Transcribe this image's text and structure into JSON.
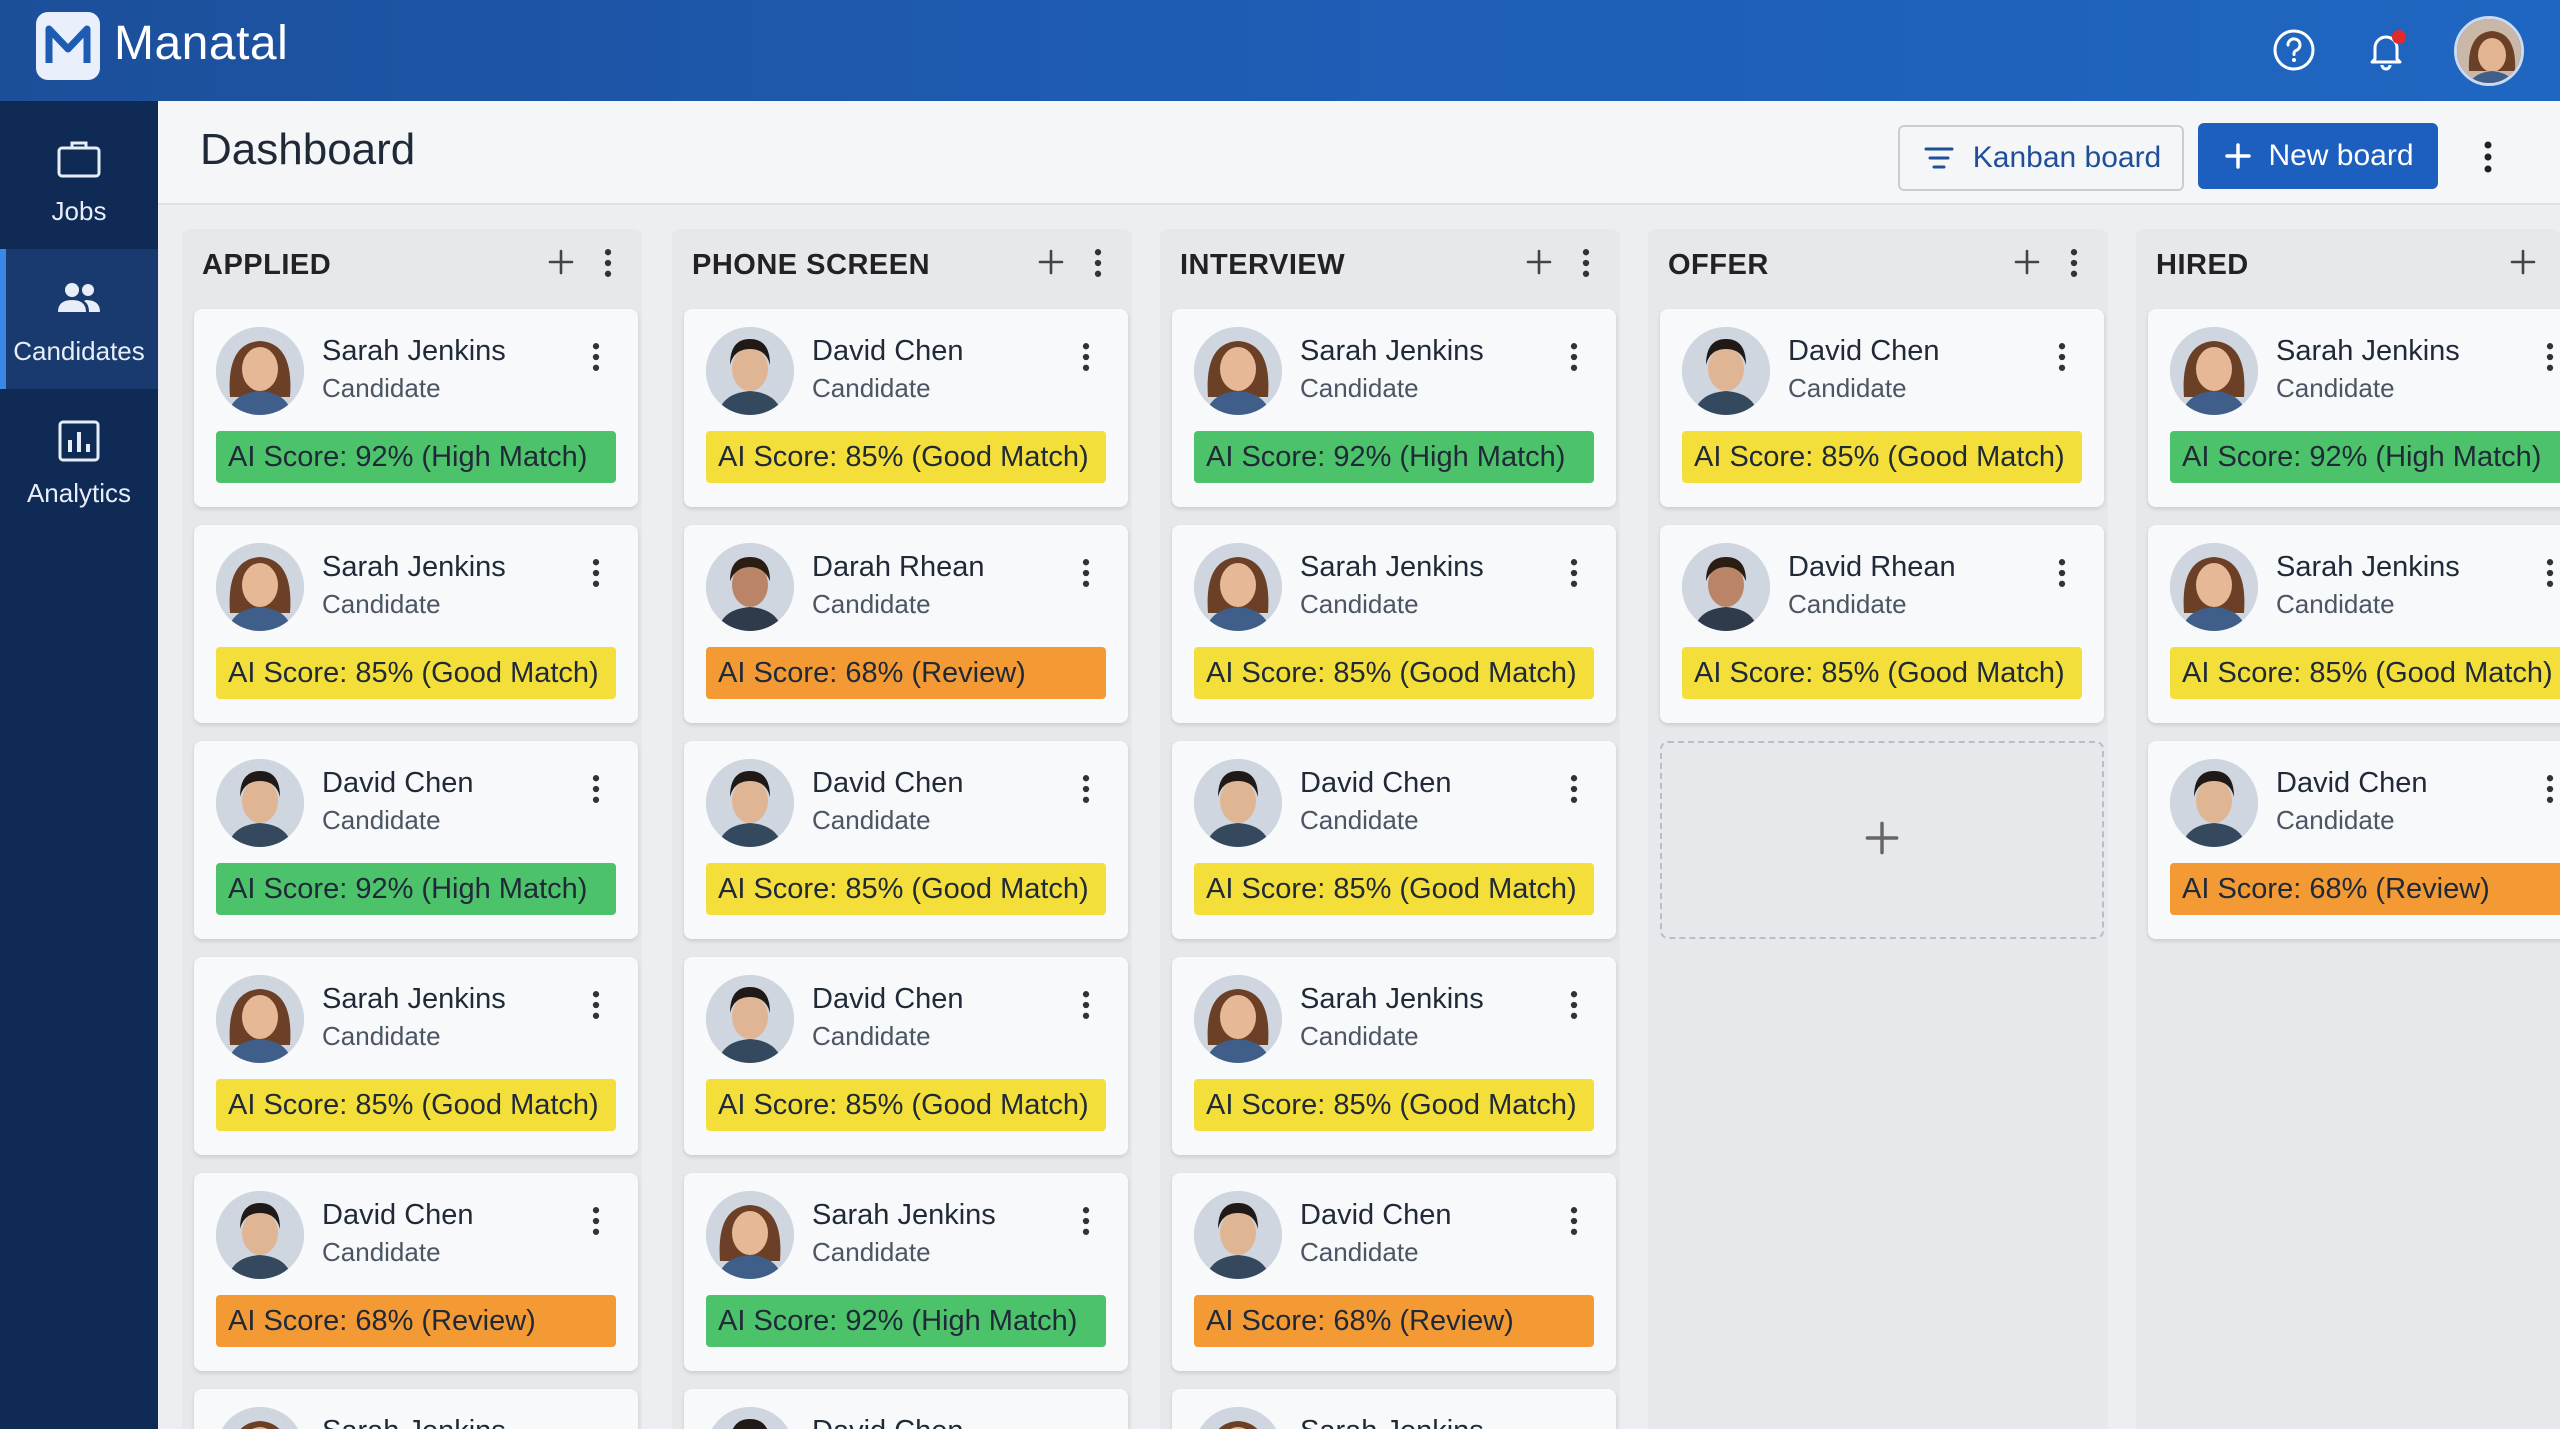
{
  "app": {
    "brand": "Manatal",
    "logo_letter": "M"
  },
  "topbar": {
    "help_icon": "help-circle-icon",
    "notification_icon": "bell-icon",
    "avatar": "user-avatar"
  },
  "sidebar": {
    "items": [
      {
        "label": "Jobs",
        "icon": "briefcase-icon",
        "active": false
      },
      {
        "label": "Candidates",
        "icon": "users-icon",
        "active": true
      },
      {
        "label": "Analytics",
        "icon": "bar-chart-icon",
        "active": false
      }
    ]
  },
  "header": {
    "title": "Dashboard",
    "kanban_label": "Kanban board",
    "new_board_label": "New board"
  },
  "colors": {
    "high_match": "#4cc26a",
    "good_match": "#f4df3a",
    "review": "#f39a35",
    "primary": "#1d5fbf",
    "topbar": "#1e5cb3",
    "sidebar": "#0f2a55"
  },
  "columns": [
    {
      "title": "APPLIED",
      "cards": [
        {
          "name": "Sarah Jenkins",
          "role": "Candidate",
          "score": "AI Score: 92% (High Match)",
          "level": "green",
          "person": "f"
        },
        {
          "name": "Sarah Jenkins",
          "role": "Candidate",
          "score": "AI Score: 85% (Good Match)",
          "level": "yellow",
          "person": "f"
        },
        {
          "name": "David Chen",
          "role": "Candidate",
          "score": "AI Score: 92% (High Match)",
          "level": "green",
          "person": "m"
        },
        {
          "name": "Sarah Jenkins",
          "role": "Candidate",
          "score": "AI Score: 85% (Good Match)",
          "level": "yellow",
          "person": "f"
        },
        {
          "name": "David Chen",
          "role": "Candidate",
          "score": "AI Score: 68% (Review)",
          "level": "orange",
          "person": "m"
        }
      ],
      "partial": {
        "name": "Sarah Jenkins",
        "person": "f"
      }
    },
    {
      "title": "PHONE SCREEN",
      "cards": [
        {
          "name": "David Chen",
          "role": "Candidate",
          "score": "AI Score: 85% (Good Match)",
          "level": "yellow",
          "person": "m"
        },
        {
          "name": "Darah Rhean",
          "role": "Candidate",
          "score": "AI Score: 68% (Review)",
          "level": "orange",
          "person": "m2"
        },
        {
          "name": "David Chen",
          "role": "Candidate",
          "score": "AI Score: 85% (Good Match)",
          "level": "yellow",
          "person": "m"
        },
        {
          "name": "David Chen",
          "role": "Candidate",
          "score": "AI Score: 85% (Good Match)",
          "level": "yellow",
          "person": "m"
        },
        {
          "name": "Sarah Jenkins",
          "role": "Candidate",
          "score": "AI Score: 92% (High Match)",
          "level": "green",
          "person": "f"
        }
      ],
      "partial": {
        "name": "David Chen",
        "person": "m"
      }
    },
    {
      "title": "INTERVIEW",
      "cards": [
        {
          "name": "Sarah Jenkins",
          "role": "Candidate",
          "score": "AI Score: 92% (High Match)",
          "level": "green",
          "person": "f"
        },
        {
          "name": "Sarah Jenkins",
          "role": "Candidate",
          "score": "AI Score: 85% (Good Match)",
          "level": "yellow",
          "person": "f"
        },
        {
          "name": "David Chen",
          "role": "Candidate",
          "score": "AI Score: 85% (Good Match)",
          "level": "yellow",
          "person": "m"
        },
        {
          "name": "Sarah Jenkins",
          "role": "Candidate",
          "score": "AI Score: 85% (Good Match)",
          "level": "yellow",
          "person": "f"
        },
        {
          "name": "David Chen",
          "role": "Candidate",
          "score": "AI Score: 68% (Review)",
          "level": "orange",
          "person": "m"
        }
      ],
      "partial": {
        "name": "Sarah Jenkins",
        "person": "f"
      }
    },
    {
      "title": "OFFER",
      "cards": [
        {
          "name": "David Chen",
          "role": "Candidate",
          "score": "AI Score: 85% (Good Match)",
          "level": "yellow",
          "person": "m"
        },
        {
          "name": "David Rhean",
          "role": "Candidate",
          "score": "AI Score: 85% (Good Match)",
          "level": "yellow",
          "person": "m2"
        }
      ],
      "add_slot": true
    },
    {
      "title": "HIRED",
      "cards": [
        {
          "name": "Sarah Jenkins",
          "role": "Candidate",
          "score": "AI Score: 92% (High Match)",
          "level": "green",
          "person": "f"
        },
        {
          "name": "Sarah Jenkins",
          "role": "Candidate",
          "score": "AI Score: 85% (Good Match)",
          "level": "yellow",
          "person": "f"
        },
        {
          "name": "David Chen",
          "role": "Candidate",
          "score": "AI Score: 68% (Review)",
          "level": "orange",
          "person": "m"
        }
      ]
    }
  ]
}
